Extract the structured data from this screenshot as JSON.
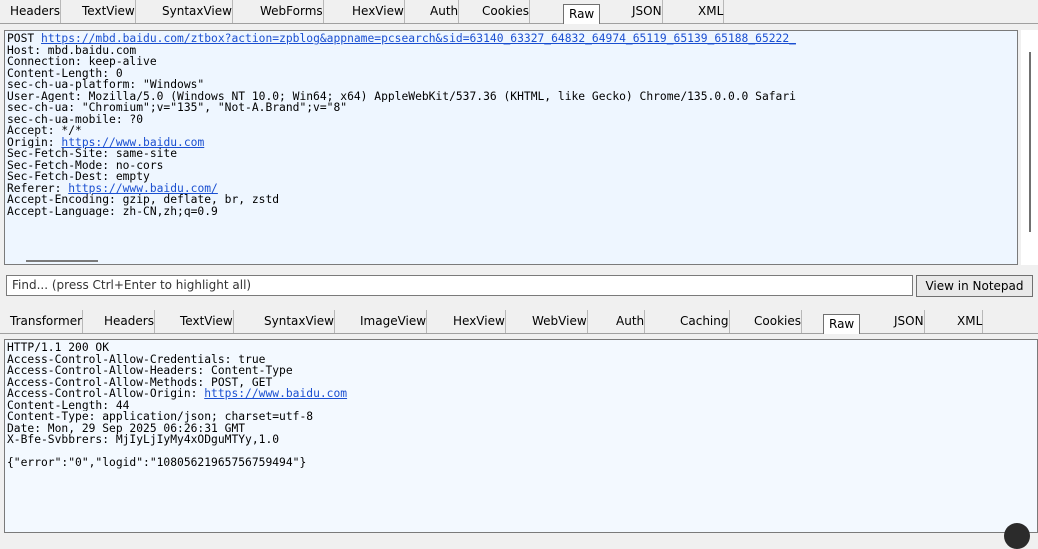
{
  "request_tabs": [
    "Headers",
    "TextView",
    "SyntaxView",
    "WebForms",
    "HexView",
    "Auth",
    "Cookies",
    "Raw",
    "JSON",
    "XML"
  ],
  "request_active_tab": "Raw",
  "request": {
    "method": "POST ",
    "url": "https://mbd.baidu.com/ztbox?action=zpblog&appname=pcsearch&sid=63140_63327_64832_64974_65119_65139_65188_65222_",
    "headers": [
      {
        "text": "Host: mbd.baidu.com"
      },
      {
        "text": "Connection: keep-alive"
      },
      {
        "text": "Content-Length: 0"
      },
      {
        "text": "sec-ch-ua-platform: \"Windows\""
      },
      {
        "text": "User-Agent: Mozilla/5.0 (Windows NT 10.0; Win64; x64) AppleWebKit/537.36 (KHTML, like Gecko) Chrome/135.0.0.0 Safari"
      },
      {
        "text": "sec-ch-ua: \"Chromium\";v=\"135\", \"Not-A.Brand\";v=\"8\""
      },
      {
        "text": "sec-ch-ua-mobile: ?0"
      },
      {
        "text": "Accept: */*"
      },
      {
        "text": "Origin: ",
        "link": "https://www.baidu.com"
      },
      {
        "text": "Sec-Fetch-Site: same-site"
      },
      {
        "text": "Sec-Fetch-Mode: no-cors"
      },
      {
        "text": "Sec-Fetch-Dest: empty"
      },
      {
        "text": "Referer: ",
        "link": "https://www.baidu.com/"
      },
      {
        "text": "Accept-Encoding: gzip, deflate, br, zstd"
      },
      {
        "text": "Accept-Language: zh-CN,zh;q=0.9"
      }
    ]
  },
  "find": {
    "placeholder": "Find... (press Ctrl+Enter to highlight all)",
    "notepad_button": "View in Notepad"
  },
  "response_tabs": [
    "Transformer",
    "Headers",
    "TextView",
    "SyntaxView",
    "ImageView",
    "HexView",
    "WebView",
    "Auth",
    "Caching",
    "Cookies",
    "Raw",
    "JSON",
    "XML"
  ],
  "response_active_tab": "Raw",
  "response": {
    "lines": [
      {
        "text": "HTTP/1.1 200 OK"
      },
      {
        "text": "Access-Control-Allow-Credentials: true"
      },
      {
        "text": "Access-Control-Allow-Headers: Content-Type"
      },
      {
        "text": "Access-Control-Allow-Methods: POST, GET"
      },
      {
        "text": "Access-Control-Allow-Origin: ",
        "link": "https://www.baidu.com"
      },
      {
        "text": "Content-Length: 44"
      },
      {
        "text": "Content-Type: application/json; charset=utf-8"
      },
      {
        "text": "Date: Mon, 29 Sep 2025 06:26:31 GMT"
      },
      {
        "text": "X-Bfe-Svbbrers: MjIyLjIyMy4xODguMTYy,1.0"
      },
      {
        "text": ""
      },
      {
        "text": "{\"error\":\"0\",\"logid\":\"10805621965756759494\"}"
      }
    ]
  }
}
